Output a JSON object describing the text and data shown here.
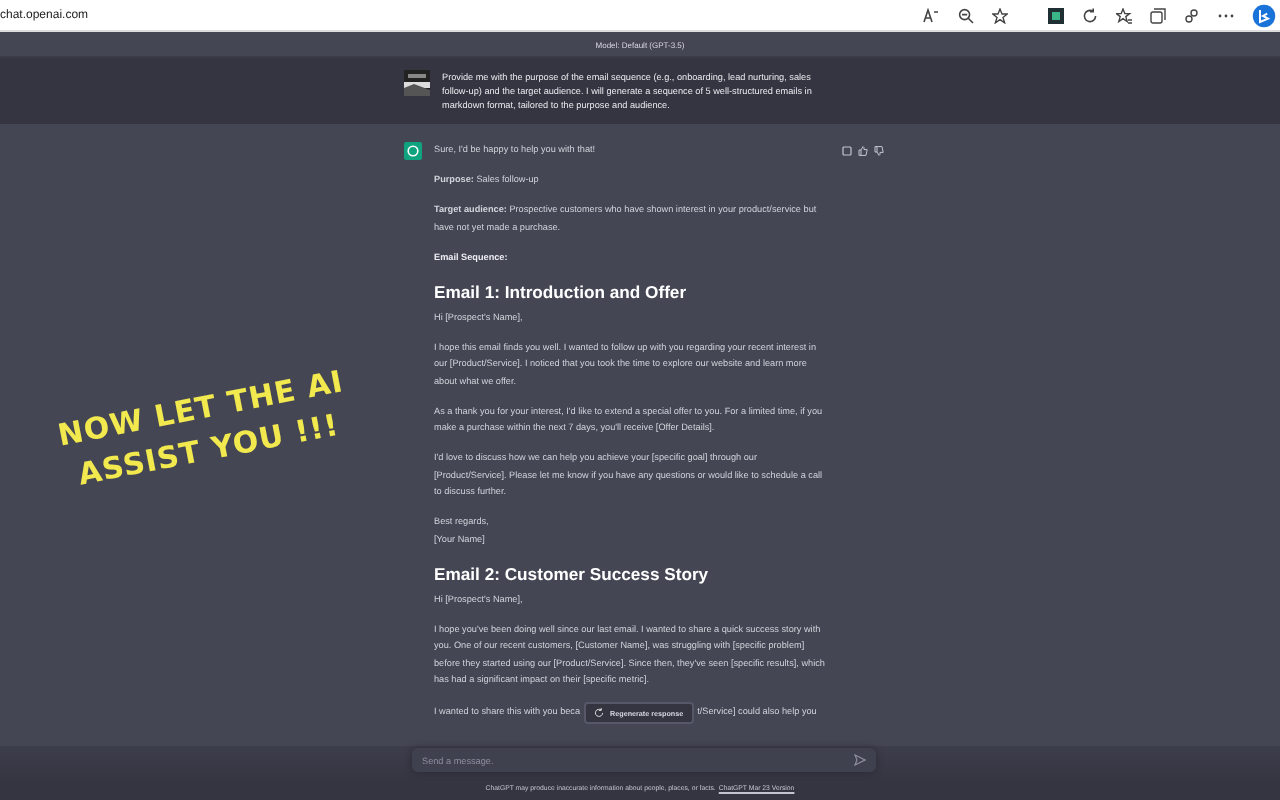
{
  "browser": {
    "url": "chat.openai.com"
  },
  "model_bar": {
    "label": "Model: Default (GPT-3.5)"
  },
  "user_message": {
    "text": "Provide me with the purpose of the email sequence (e.g., onboarding, lead nurturing, sales follow-up) and the target audience. I will generate a sequence of 5 well-structured emails in markdown format, tailored to the purpose and audience."
  },
  "assistant_message": {
    "blocks": [
      {
        "kind": "p",
        "text": "Sure, I'd be happy to help you with that!"
      },
      {
        "kind": "p",
        "text": "**Purpose:** Sales follow-up"
      },
      {
        "kind": "p",
        "text": "**Target audience:** Prospective customers who have shown interest in your product/service but have not yet made a purchase."
      },
      {
        "kind": "strong",
        "text": "Email Sequence:"
      },
      {
        "kind": "h",
        "text": "Email 1: Introduction and Offer"
      },
      {
        "kind": "p",
        "text": "Hi [Prospect's Name],"
      },
      {
        "kind": "p",
        "text": "I hope this email finds you well. I wanted to follow up with you regarding your recent interest in our [Product/Service]. I noticed that you took the time to explore our website and learn more about what we offer."
      },
      {
        "kind": "p",
        "text": "As a thank you for your interest, I'd like to extend a special offer to you. For a limited time, if you make a purchase within the next 7 days, you'll receive [Offer Details]."
      },
      {
        "kind": "p",
        "text": "I'd love to discuss how we can help you achieve your [specific goal] through our [Product/Service]. Please let me know if you have any questions or would like to schedule a call to discuss further."
      },
      {
        "kind": "lines",
        "lines": [
          "Best regards,",
          "[Your Name]"
        ]
      },
      {
        "kind": "h",
        "text": "Email 2: Customer Success Story"
      },
      {
        "kind": "p",
        "text": "Hi [Prospect's Name],"
      },
      {
        "kind": "p",
        "text": "I hope you've been doing well since our last email. I wanted to share a quick success story with you. One of our recent customers, [Customer Name], was struggling with [specific problem] before they started using our [Product/Service]. Since then, they've seen [specific results], which has had a significant impact on their [specific metric]."
      },
      {
        "kind": "split",
        "parts": [
          "I wanted to share this with you beca",
          "t/Service] could also help you"
        ]
      }
    ]
  },
  "overlay_caption": [
    "NOW LET THE AI",
    "ASSIST YOU !!!"
  ],
  "regenerate_button": {
    "label": "Regenerate response"
  },
  "composer": {
    "placeholder": "Send a message."
  },
  "footer": {
    "text": "ChatGPT may produce inaccurate information about people, places, or facts.",
    "link": "ChatGPT Mar 23 Version"
  }
}
